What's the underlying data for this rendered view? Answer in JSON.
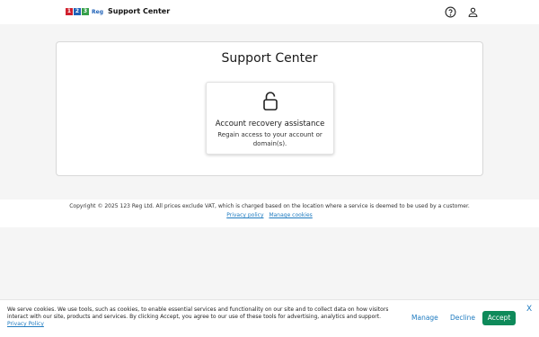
{
  "header": {
    "logo": {
      "d1": "1",
      "d2": "2",
      "d3": "3",
      "reg": "Reg"
    },
    "title": "Support Center",
    "icons": {
      "help": "help-circle-icon",
      "account": "user-icon"
    }
  },
  "main": {
    "title": "Support Center",
    "tile": {
      "icon": "lock-icon",
      "title": "Account recovery assistance",
      "description": "Regain access to your account or domain(s)."
    }
  },
  "footer": {
    "copyright": "Copyright © 2025 123 Reg Ltd. All prices exclude VAT, which is charged based on the location where a service is deemed to be used by a customer.",
    "privacy_link": "Privacy policy",
    "manage_cookies_link": "Manage cookies"
  },
  "cookie_banner": {
    "text": "We serve cookies. We use tools, such as cookies, to enable essential services and functionality on our site and to collect data on how visitors interact with our site, products and services. By clicking Accept, you agree to our use of these tools for advertising, analytics and support.",
    "privacy_link": "Privacy Policy",
    "manage": "Manage",
    "decline": "Decline",
    "accept": "Accept",
    "close": "X"
  },
  "colors": {
    "accent_green": "#0e8a5a",
    "link_blue": "#1f7bc0",
    "background": "#f5f5f5"
  }
}
